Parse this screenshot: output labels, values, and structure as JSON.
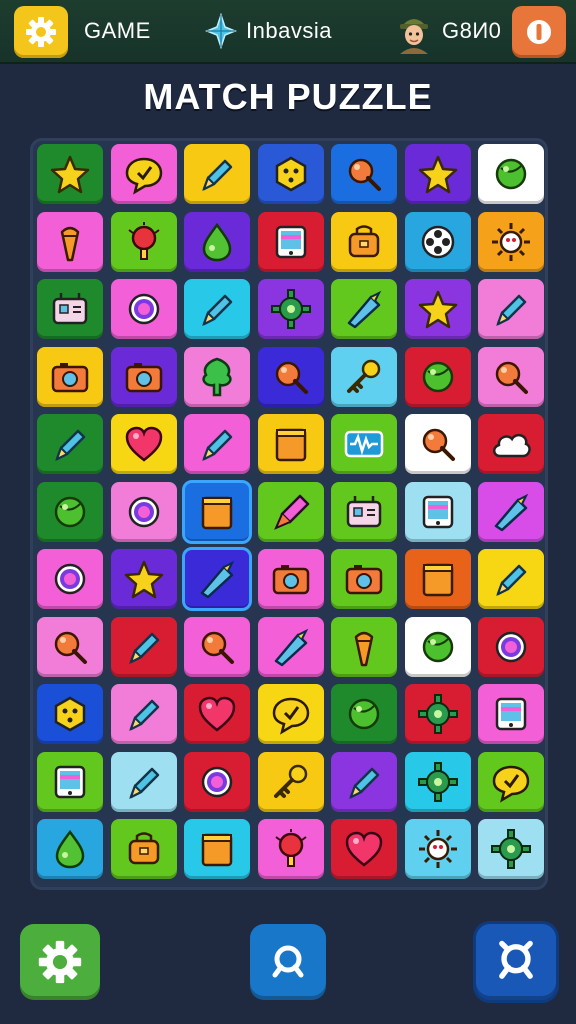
{
  "header": {
    "game_label": "GAME",
    "player_name": "Inbavsia",
    "right_label": "G8И0"
  },
  "title": "MATCH PUZZLE",
  "colors": {
    "background": "#1f2a40",
    "topbar": "#1d3d2e",
    "selection": "#3aa6ff"
  },
  "board": {
    "rows": 11,
    "cols": 7,
    "tiles": [
      [
        {
          "c": "#1e8a2b",
          "i": "star"
        },
        {
          "c": "#f25fd7",
          "i": "chat"
        },
        {
          "c": "#f7c913",
          "i": "pen"
        },
        {
          "c": "#2a59d8",
          "i": "hex"
        },
        {
          "c": "#1a6ee0",
          "i": "pin"
        },
        {
          "c": "#6a2ad8",
          "i": "star"
        },
        {
          "c": "#ffffff",
          "i": "ball"
        }
      ],
      [
        {
          "c": "#f25fd7",
          "i": "cone"
        },
        {
          "c": "#62c81d",
          "i": "bulb"
        },
        {
          "c": "#6a2ad8",
          "i": "drop"
        },
        {
          "c": "#d81d33",
          "i": "device"
        },
        {
          "c": "#f7c913",
          "i": "bag"
        },
        {
          "c": "#27a6e0",
          "i": "film"
        },
        {
          "c": "#f5a21a",
          "i": "sun"
        }
      ],
      [
        {
          "c": "#1e8a2b",
          "i": "robot"
        },
        {
          "c": "#f25fd7",
          "i": "ring"
        },
        {
          "c": "#27c8e8",
          "i": "pen"
        },
        {
          "c": "#8a35e0",
          "i": "gear"
        },
        {
          "c": "#62c81d",
          "i": "shuttle"
        },
        {
          "c": "#8a35e0",
          "i": "star"
        },
        {
          "c": "#f27dd8",
          "i": "pen"
        }
      ],
      [
        {
          "c": "#f7c913",
          "i": "camera"
        },
        {
          "c": "#6a2ad8",
          "i": "camera"
        },
        {
          "c": "#f27dd8",
          "i": "tree"
        },
        {
          "c": "#3a2ad8",
          "i": "pin"
        },
        {
          "c": "#5fd0f0",
          "i": "key"
        },
        {
          "c": "#d81d33",
          "i": "ball"
        },
        {
          "c": "#f27dd8",
          "i": "pin"
        }
      ],
      [
        {
          "c": "#1e8a2b",
          "i": "pen"
        },
        {
          "c": "#f7d713",
          "i": "heart"
        },
        {
          "c": "#f25fd7",
          "i": "pen"
        },
        {
          "c": "#f7c913",
          "i": "box"
        },
        {
          "c": "#62c81d",
          "i": "wave"
        },
        {
          "c": "#ffffff",
          "i": "pin"
        },
        {
          "c": "#d81d33",
          "i": "cloud"
        }
      ],
      [
        {
          "c": "#1e8a2b",
          "i": "ball"
        },
        {
          "c": "#f27dd8",
          "i": "ring"
        },
        {
          "c": "#1a6ee0",
          "i": "box",
          "sel": true
        },
        {
          "c": "#62c81d",
          "i": "rocket"
        },
        {
          "c": "#62c81d",
          "i": "robot"
        },
        {
          "c": "#9ee0f2",
          "i": "device"
        },
        {
          "c": "#d84de8",
          "i": "shuttle"
        }
      ],
      [
        {
          "c": "#f25fd7",
          "i": "ring"
        },
        {
          "c": "#6a2ad8",
          "i": "star"
        },
        {
          "c": "#3a2ad8",
          "i": "shuttle",
          "sel": true
        },
        {
          "c": "#f25fd7",
          "i": "camera"
        },
        {
          "c": "#62c81d",
          "i": "camera"
        },
        {
          "c": "#e8621a",
          "i": "box"
        },
        {
          "c": "#f7d713",
          "i": "pen"
        }
      ],
      [
        {
          "c": "#f27dd8",
          "i": "pin"
        },
        {
          "c": "#d81d33",
          "i": "pen"
        },
        {
          "c": "#f25fd7",
          "i": "pin"
        },
        {
          "c": "#f25fd7",
          "i": "shuttle"
        },
        {
          "c": "#62c81d",
          "i": "cone"
        },
        {
          "c": "#ffffff",
          "i": "ball"
        },
        {
          "c": "#d81d33",
          "i": "ring"
        }
      ],
      [
        {
          "c": "#1a4fd8",
          "i": "hex"
        },
        {
          "c": "#f27dd8",
          "i": "pen"
        },
        {
          "c": "#d81d33",
          "i": "heart"
        },
        {
          "c": "#f7d713",
          "i": "chat"
        },
        {
          "c": "#1e8a2b",
          "i": "ball"
        },
        {
          "c": "#d81d33",
          "i": "gear"
        },
        {
          "c": "#f25fd7",
          "i": "device"
        }
      ],
      [
        {
          "c": "#62c81d",
          "i": "device"
        },
        {
          "c": "#9ee0f2",
          "i": "pen"
        },
        {
          "c": "#d81d33",
          "i": "ring"
        },
        {
          "c": "#f7c913",
          "i": "key"
        },
        {
          "c": "#8a35e0",
          "i": "pen"
        },
        {
          "c": "#27c8e8",
          "i": "gear"
        },
        {
          "c": "#62c81d",
          "i": "chat"
        }
      ],
      [
        {
          "c": "#27a6e0",
          "i": "drop"
        },
        {
          "c": "#62c81d",
          "i": "bag"
        },
        {
          "c": "#27c8e8",
          "i": "box"
        },
        {
          "c": "#f25fd7",
          "i": "bulb"
        },
        {
          "c": "#d81d33",
          "i": "heart"
        },
        {
          "c": "#5fd0f0",
          "i": "sun"
        },
        {
          "c": "#9ee0f2",
          "i": "gear"
        }
      ]
    ]
  },
  "bottom": {
    "settings_icon": "gear-icon",
    "search_icon": "magnifier-icon"
  }
}
